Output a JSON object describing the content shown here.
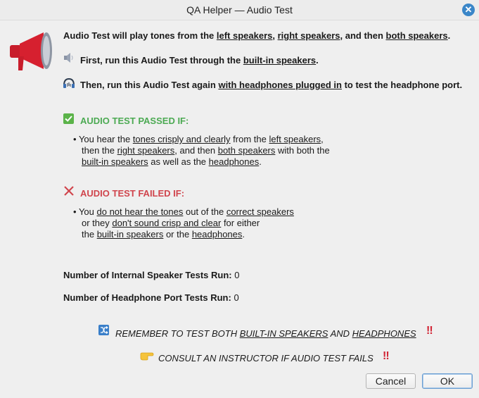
{
  "window": {
    "title": "QA Helper — Audio Test"
  },
  "intro": {
    "p1": "Audio Test will play tones from the ",
    "left": "left speakers",
    "sep1": ", ",
    "right": "right speakers",
    "sep2": ", and then ",
    "both": "both speakers",
    "end": "."
  },
  "step1": {
    "pre": "First, run this Audio Test through the ",
    "link": "built-in speakers",
    "end": "."
  },
  "step2": {
    "pre": "Then, run this Audio Test again ",
    "link": "with headphones plugged in",
    "end": " to test the headphone port."
  },
  "passed": {
    "heading": "AUDIO TEST PASSED IF:",
    "l1_pre": "You hear the ",
    "l1_u1": "tones crisply and clearly",
    "l1_mid": " from the ",
    "l1_u2": "left speakers",
    "l1_end": ",",
    "l2_pre": "then the ",
    "l2_u1": "right speakers",
    "l2_mid": ", and then ",
    "l2_u2": "both speakers",
    "l2_end": " with both the",
    "l3_u1": "built-in speakers",
    "l3_mid": " as well as the ",
    "l3_u2": "headphones",
    "l3_end": "."
  },
  "failed": {
    "heading": "AUDIO TEST FAILED IF:",
    "l1_pre": "You ",
    "l1_u1": "do not hear the tones",
    "l1_mid": " out of the ",
    "l1_u2": "correct speakers",
    "l2_pre": "or they ",
    "l2_u1": "don't sound crisp and clear",
    "l2_end": " for either",
    "l3_pre": "the ",
    "l3_u1": "built-in speakers",
    "l3_mid": " or the ",
    "l3_u2": "headphones",
    "l3_end": "."
  },
  "counters": {
    "internal_label": "Number of Internal Speaker Tests Run:",
    "internal_value": "0",
    "headphone_label": "Number of Headphone Port Tests Run:",
    "headphone_value": "0"
  },
  "reminder": {
    "pre": "REMEMBER TO TEST BOTH ",
    "u1": "BUILT-IN SPEAKERS",
    "mid": " AND ",
    "u2": "HEADPHONES",
    "bang": "!!"
  },
  "consult": {
    "text": "CONSULT AN INSTRUCTOR IF AUDIO TEST FAILS",
    "bang": "!!"
  },
  "buttons": {
    "cancel": "Cancel",
    "ok": "OK"
  },
  "colors": {
    "pass": "#4caa53",
    "fail": "#d0454d",
    "megaphone": "#d0202e",
    "accent": "#3a86c8"
  },
  "icons": [
    "megaphone-icon",
    "speaker-icon",
    "headphones-icon",
    "check-icon",
    "cross-icon",
    "shuffle-icon",
    "pointing-hand-icon",
    "close-icon"
  ]
}
